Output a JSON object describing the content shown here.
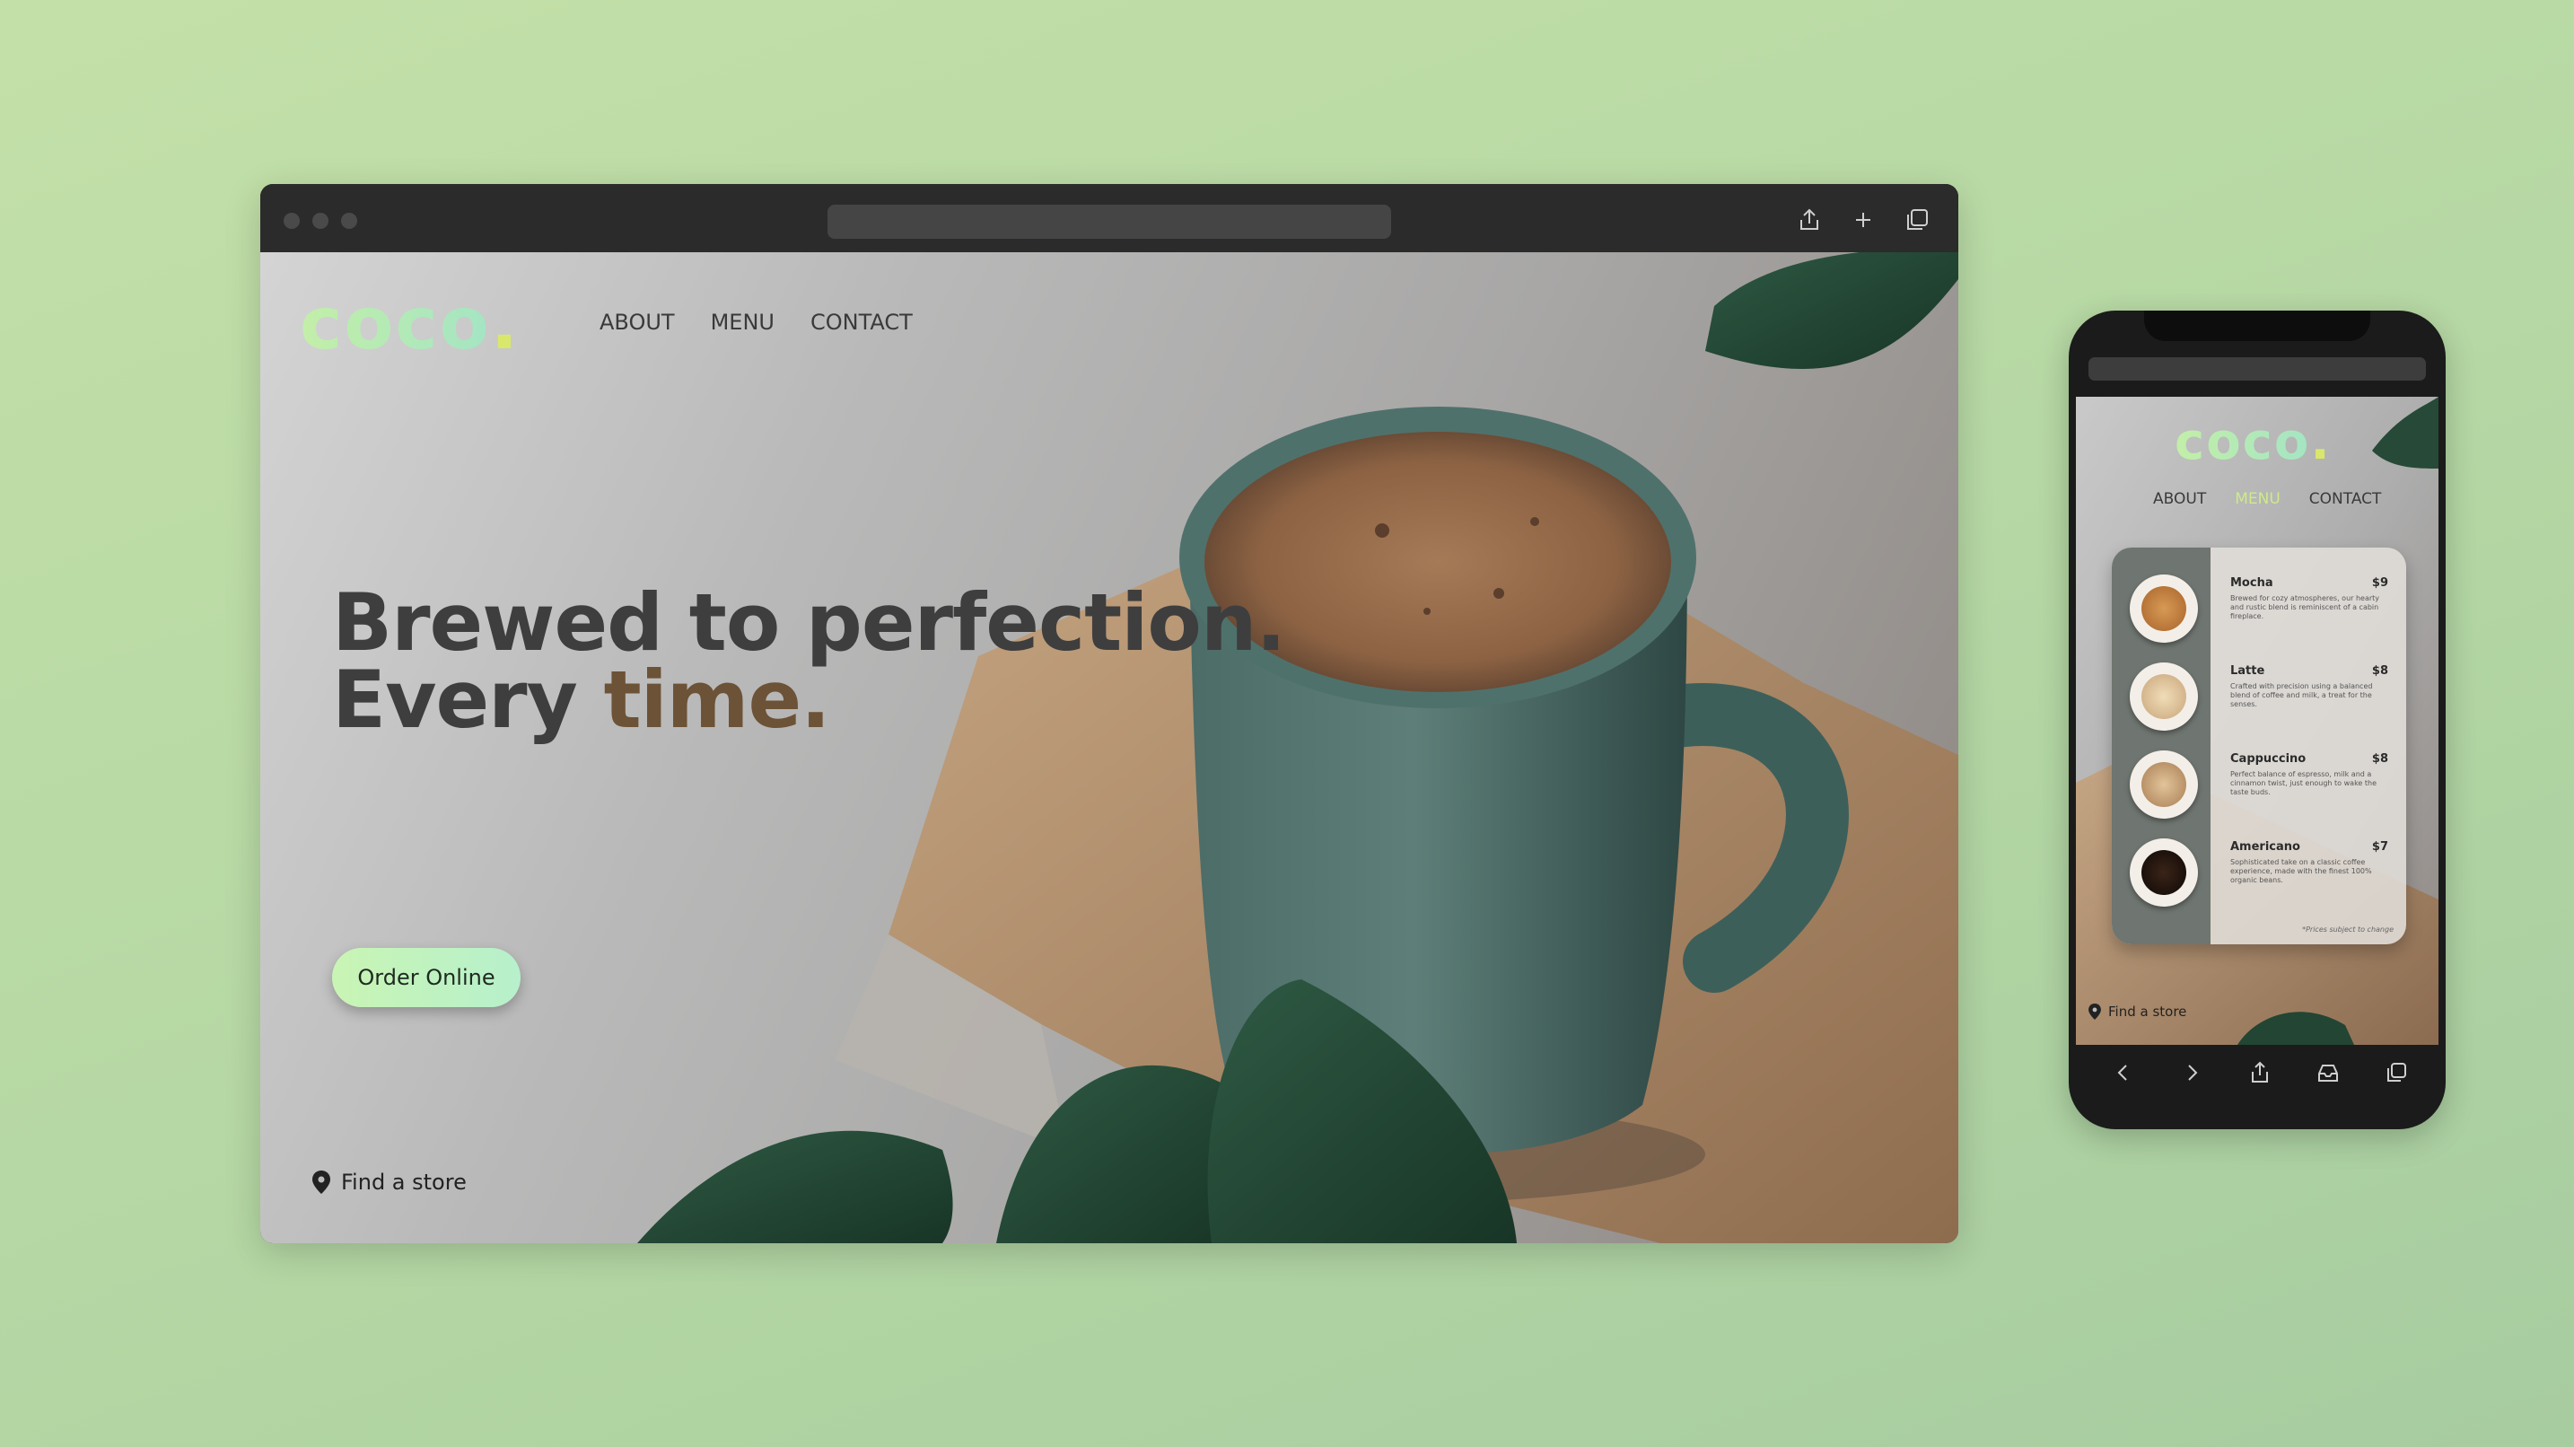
{
  "desktop": {
    "brand": "coco",
    "brand_dot": ".",
    "nav": [
      "ABOUT",
      "MENU",
      "CONTACT"
    ],
    "headline_line1": "Brewed to perfection.",
    "headline_line2_a": "Every ",
    "headline_line2_b": "time.",
    "cta": "Order Online",
    "find_store": "Find a store",
    "toolbar_icons": [
      "share-icon",
      "plus-icon",
      "tabs-icon"
    ]
  },
  "mobile": {
    "brand": "coco",
    "brand_dot": ".",
    "nav": [
      "ABOUT",
      "MENU",
      "CONTACT"
    ],
    "active_nav": "MENU",
    "menu": [
      {
        "name": "Mocha",
        "price": "$9",
        "desc": "Brewed for cozy atmospheres, our hearty and rustic blend is reminiscent of a cabin fireplace."
      },
      {
        "name": "Latte",
        "price": "$8",
        "desc": "Crafted with precision using a balanced blend of coffee and milk, a treat for the senses."
      },
      {
        "name": "Cappuccino",
        "price": "$8",
        "desc": "Perfect balance of espresso, milk and a cinnamon twist, just enough to wake the taste buds."
      },
      {
        "name": "Americano",
        "price": "$7",
        "desc": "Sophisticated take on a classic coffee experience, made with the finest 100% organic beans."
      }
    ],
    "price_note": "*Prices subject to change",
    "find_store": "Find a store",
    "bottom_icons": [
      "back-icon",
      "forward-icon",
      "share-icon",
      "inbox-icon",
      "tabs-icon"
    ]
  },
  "colors": {
    "background": "#b9daa5",
    "brand_gradient_start": "#c3efa8",
    "brand_gradient_end": "#9fe3c8",
    "accent_text": "#6c5236",
    "mobile_active_nav": "#cdea8a"
  }
}
